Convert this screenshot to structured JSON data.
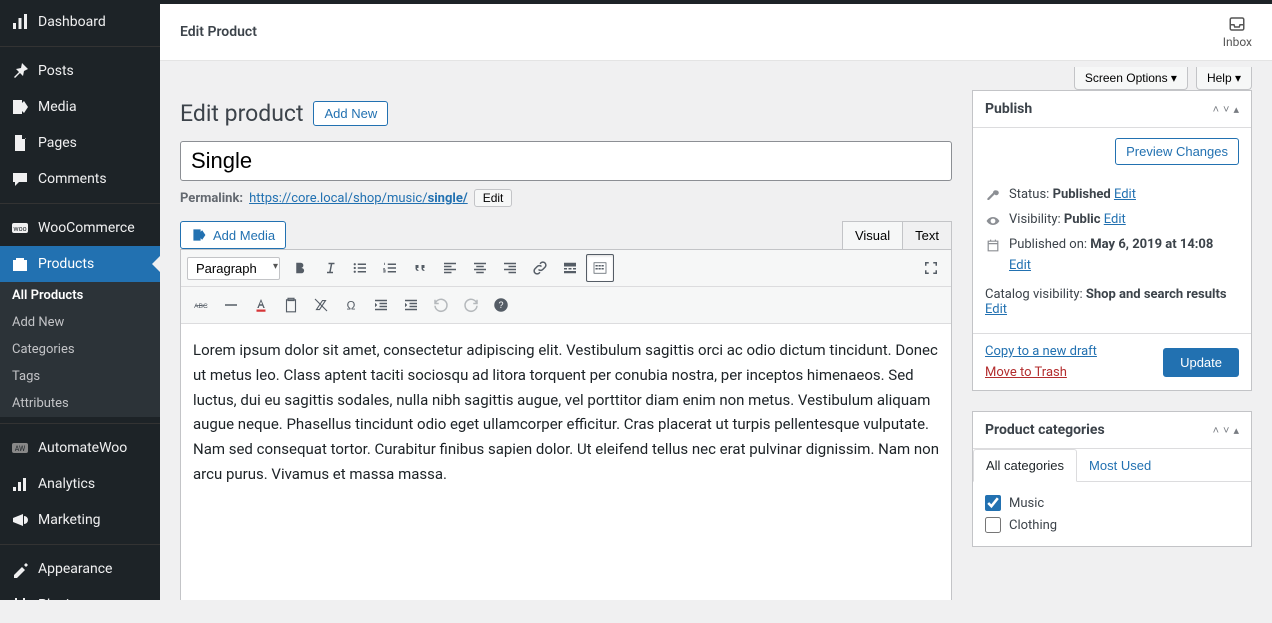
{
  "sidebar": {
    "items": [
      {
        "label": "Dashboard"
      },
      {
        "label": "Posts"
      },
      {
        "label": "Media"
      },
      {
        "label": "Pages"
      },
      {
        "label": "Comments"
      },
      {
        "label": "WooCommerce"
      },
      {
        "label": "Products"
      },
      {
        "label": "AutomateWoo"
      },
      {
        "label": "Analytics"
      },
      {
        "label": "Marketing"
      },
      {
        "label": "Appearance"
      },
      {
        "label": "Plugins"
      }
    ],
    "subitems": [
      {
        "label": "All Products"
      },
      {
        "label": "Add New"
      },
      {
        "label": "Categories"
      },
      {
        "label": "Tags"
      },
      {
        "label": "Attributes"
      }
    ]
  },
  "header": {
    "title": "Edit Product",
    "inbox_label": "Inbox"
  },
  "screen_options": {
    "screen": "Screen Options ▾",
    "help": "Help ▾"
  },
  "page": {
    "heading": "Edit product",
    "add_new": "Add New"
  },
  "title_input": "Single",
  "permalink": {
    "label": "Permalink:",
    "url_base": "https://core.local/shop/music/",
    "slug": "single/",
    "edit": "Edit"
  },
  "media": {
    "add_media": "Add Media"
  },
  "editor": {
    "tabs": {
      "visual": "Visual",
      "text": "Text"
    },
    "format_select": "Paragraph",
    "content": "Lorem ipsum dolor sit amet, consectetur adipiscing elit. Vestibulum sagittis orci ac odio dictum tincidunt. Donec ut metus leo. Class aptent taciti sociosqu ad litora torquent per conubia nostra, per inceptos himenaeos. Sed luctus, dui eu sagittis sodales, nulla nibh sagittis augue, vel porttitor diam enim non metus. Vestibulum aliquam augue neque. Phasellus tincidunt odio eget ullamcorper efficitur. Cras placerat ut turpis pellentesque vulputate. Nam sed consequat tortor. Curabitur finibus sapien dolor. Ut eleifend tellus nec erat pulvinar dignissim. Nam non arcu purus. Vivamus et massa massa."
  },
  "publish": {
    "title": "Publish",
    "preview": "Preview Changes",
    "status_label": "Status:",
    "status_value": "Published",
    "status_edit": "Edit",
    "visibility_label": "Visibility:",
    "visibility_value": "Public",
    "visibility_edit": "Edit",
    "published_label": "Published on:",
    "published_value": "May 6, 2019 at 14:08",
    "published_edit": "Edit",
    "catalog_label": "Catalog visibility:",
    "catalog_value": "Shop and search results",
    "catalog_edit": "Edit",
    "copy_draft": "Copy to a new draft",
    "trash": "Move to Trash",
    "update": "Update"
  },
  "categories": {
    "title": "Product categories",
    "tab_all": "All categories",
    "tab_most": "Most Used",
    "items": [
      {
        "label": "Music",
        "checked": true
      },
      {
        "label": "Clothing",
        "checked": false
      }
    ]
  }
}
